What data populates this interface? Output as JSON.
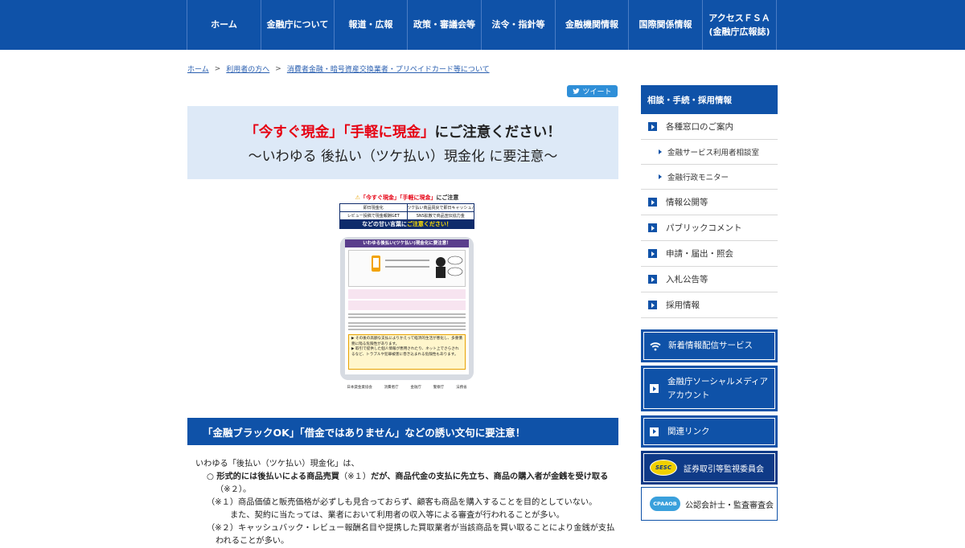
{
  "nav": {
    "items": [
      {
        "label": "ホーム",
        "w": 92
      },
      {
        "label": "金融庁について",
        "w": 91
      },
      {
        "label": "報道・広報",
        "w": 91
      },
      {
        "label": "政策・審議会等",
        "w": 92
      },
      {
        "label": "法令・指針等",
        "w": 92
      },
      {
        "label": "金融機関情報",
        "w": 91
      },
      {
        "label": "国際関係情報",
        "w": 92
      },
      {
        "label": "アクセスＦＳＡ\n(金融庁広報誌)",
        "w": 92
      }
    ]
  },
  "breadcrumb": {
    "home": "ホーム",
    "sep": ">",
    "level1": "利用者の方へ",
    "level2": "消費者金融・暗号資産交換業者・プリペイドカード等について"
  },
  "tweet": {
    "label": "ツイート"
  },
  "title": {
    "red1": "「今すぐ現金」",
    "red2": "「手軽に現金」",
    "tail": "にご注意ください！",
    "line2": "〜いわゆる 後払い（ツケ払い）現金化 に要注意〜"
  },
  "poster": {
    "head_red": "「今すぐ現金」「手軽に現金」",
    "head_tail": "にご注意",
    "grid": [
      "即日現金化",
      "ツケ払い商品買戻で即日キャッシュバック",
      "レビュー投稿で現金報酬GET",
      "SNS拡散で商品宣伝協力金"
    ],
    "banner_a": "などの甘い言葉に",
    "banner_b": "ご注意ください！",
    "screen_title": "いわゆる後払い(ツケ払い)現金化に要注意！",
    "warn1": "▶ その後の高額な支払によりかえって経済的生活が悪化し、多重債務に陥る危険性があります。",
    "warn2": "▶ 取引で提供した個人情報が悪用されたり、ネット上でさらされるなど、トラブルや犯罪被害に巻き込まれる危険性もあります。",
    "logos": [
      "日本貸金業協会",
      "消費者庁",
      "金融庁",
      "警察庁",
      "法務省"
    ]
  },
  "section": {
    "heading": "「金融ブラックOK」「借金ではありません」などの誘い文句に要注意！"
  },
  "body": {
    "intro": "いわゆる「後払い（ツケ払い）現金化」は、",
    "bullet_a": "○ 形式的には後払いによる商品売買",
    "bullet_b": "（※１）",
    "bullet_c": "だが、商品代金の支払に先立ち、商品の購入者が金銭を受け取る",
    "bullet_cont": "（※２）。",
    "note1": "（※１）商品価値と販売価格が必ずしも見合っておらず、顧客も商品を購入することを目的としていない。",
    "note1_cont": "また、契約に当たっては、業者において利用者の収入等による審査が行われることが多い。",
    "note2": "（※２）キャッシュバック・レビュー報酬名目や提携した買取業者が当該商品を買い取ることにより金銭が支払",
    "note2_cont": "われることが多い。"
  },
  "sidebar": {
    "heading": "相談・手続・採用情報",
    "items": [
      {
        "label": "各種窓口のご案内",
        "type": "main"
      },
      {
        "label": "金融サービス利用者相談室",
        "type": "sub"
      },
      {
        "label": "金融行政モニター",
        "type": "sub"
      },
      {
        "label": "情報公開等",
        "type": "main"
      },
      {
        "label": "パブリックコメント",
        "type": "main"
      },
      {
        "label": "申請・届出・照会",
        "type": "main"
      },
      {
        "label": "入札公告等",
        "type": "main"
      },
      {
        "label": "採用情報",
        "type": "main"
      }
    ],
    "btn_news": "新着情報配信サービス",
    "btn_social": "金融庁ソーシャルメディア\nアカウント",
    "btn_links": "関連リンク",
    "sesc_badge": "SESC",
    "sesc_label": "証券取引等監視委員会",
    "cpaaob_badge": "CPAAOB",
    "cpaaob_label": "公認会計士・監査審査会"
  },
  "colors": {
    "brand_blue": "#0f52a8",
    "title_bg": "#dde9f7",
    "alert_red": "#e60012"
  }
}
